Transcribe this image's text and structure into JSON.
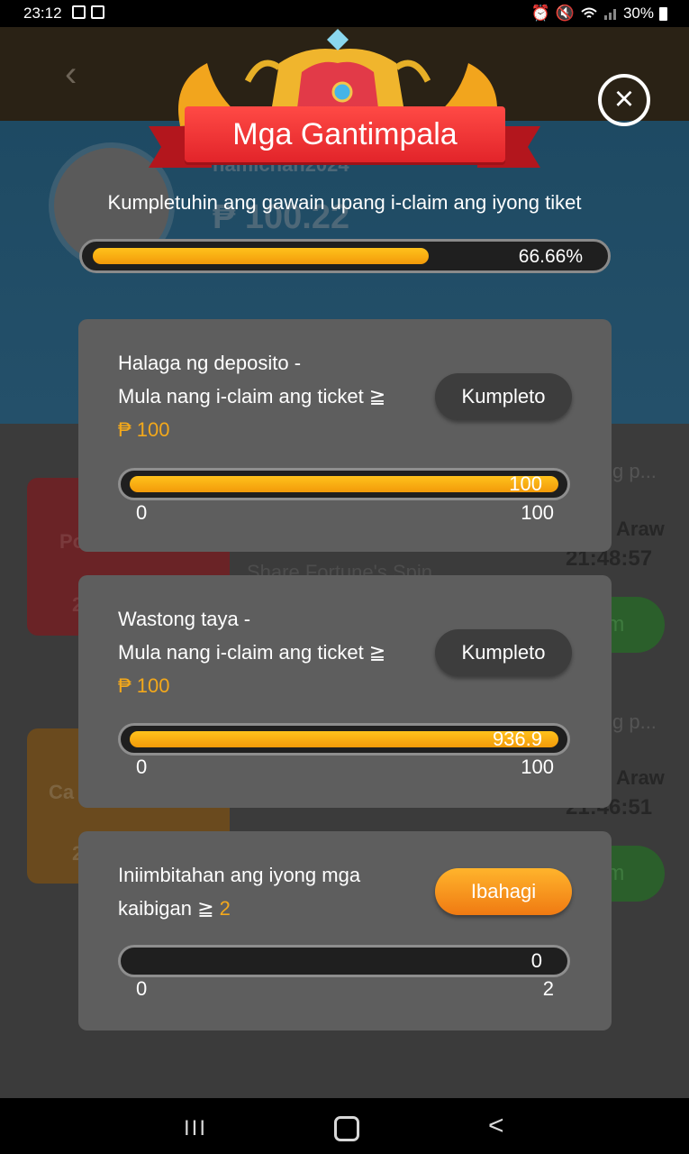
{
  "status_bar": {
    "time": "23:12",
    "battery": "30%",
    "icons": [
      "image-icon",
      "checkbox-icon",
      "alarm-icon",
      "mute-icon",
      "wifi-icon",
      "signal-icon",
      "battery-icon"
    ]
  },
  "background": {
    "username": "namichan2024",
    "balance": "₱ 100.22",
    "card1_code": "Po",
    "card1_partial": "2",
    "card2_code": "Ca",
    "card2_partial": "2",
    "row1_desc": "Share Fortune's Spin",
    "row1_trunc": "g p...",
    "row1_day": "Araw",
    "row1_time": "21:48:57",
    "row1_btn": "im",
    "row2_desc": "",
    "row2_trunc": "g p...",
    "row2_day": "Araw",
    "row2_time": "21:46:51",
    "row2_btn": "im"
  },
  "modal": {
    "title": "Mga Gantimpala",
    "subtitle": "Kumpletuhin ang gawain upang i-claim ang iyong tiket",
    "progress_percent": "66.66%",
    "progress_fraction": 0.6666,
    "close_icon": "close-icon",
    "tasks": [
      {
        "line1": "Halaga ng deposito -",
        "line2": "Mula nang i-claim ang ticket ≧",
        "amount": "₱ 100",
        "button": "Kumpleto",
        "current": "100",
        "min": "0",
        "max": "100",
        "fill_fraction": 1.0
      },
      {
        "line1": "Wastong taya -",
        "line2": "Mula nang i-claim ang ticket ≧",
        "amount": "₱ 100",
        "button": "Kumpleto",
        "current": "936.9",
        "min": "0",
        "max": "100",
        "fill_fraction": 1.0
      },
      {
        "line1": "Iniimbitahan ang iyong mga",
        "line2": "kaibigan ≧",
        "amount": "2",
        "button": "Ibahagi",
        "current": "0",
        "min": "0",
        "max": "2",
        "fill_fraction": 0.0
      }
    ]
  },
  "colors": {
    "accent_orange": "#f39a09",
    "amount_text": "#f3a81b",
    "ribbon_red": "#e2242a",
    "card_bg": "#5e5e5e"
  },
  "nav_bar": {
    "icons": [
      "recents-icon",
      "home-icon",
      "back-icon"
    ],
    "recents_glyph": "III",
    "back_glyph": "<"
  }
}
